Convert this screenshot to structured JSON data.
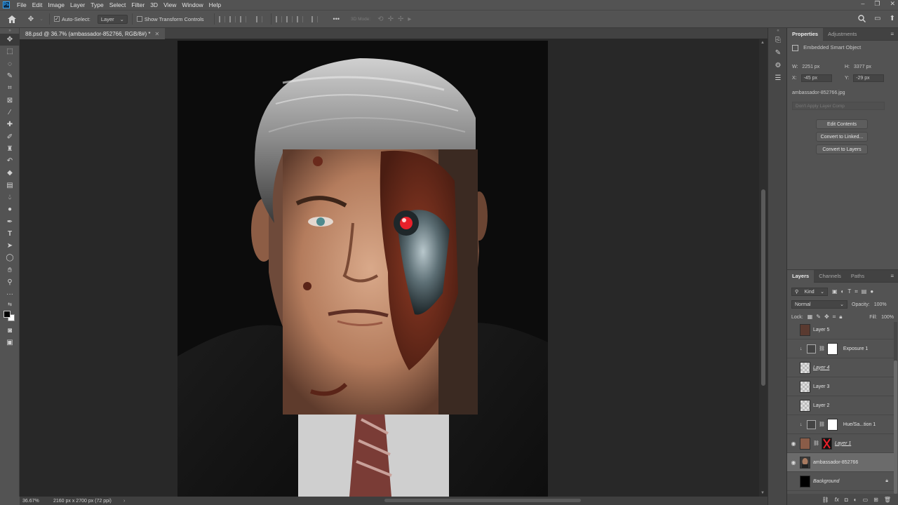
{
  "menubar": {
    "app_logo": "Ps",
    "items": [
      "File",
      "Edit",
      "Image",
      "Layer",
      "Type",
      "Select",
      "Filter",
      "3D",
      "View",
      "Window",
      "Help"
    ],
    "minimize": "–",
    "restore": "❐",
    "close": "✕"
  },
  "options_bar": {
    "auto_select_label": "Auto-Select:",
    "auto_select_checked": "✓",
    "auto_select_target": "Layer",
    "show_transform_label": "Show Transform Controls",
    "more": "•••",
    "mode_3d": "3D Mode:"
  },
  "document": {
    "tab_title": "88.psd @ 36.7% (ambassador-852766, RGB/8#) *",
    "close": "✕"
  },
  "status": {
    "zoom": "36.67%",
    "doc_info": "2160 px x 2700 px (72 ppi)",
    "arrow": "›"
  },
  "properties": {
    "tabs": [
      "Properties",
      "Adjustments"
    ],
    "type_label": "Embedded Smart Object",
    "w_label": "W:",
    "w_value": "2251 px",
    "h_label": "H:",
    "h_value": "3377 px",
    "x_label": "X:",
    "x_value": "-45 px",
    "y_label": "Y:",
    "y_value": "-29 px",
    "filename": "ambassador-852766.jpg",
    "layer_comp_placeholder": "Don't Apply Layer Comp",
    "buttons": [
      "Edit Contents",
      "Convert to Linked...",
      "Convert to Layers"
    ]
  },
  "layers_panel": {
    "tabs": [
      "Layers",
      "Channels",
      "Paths"
    ],
    "filter_kind": "Kind",
    "blend_mode": "Normal",
    "opacity_label": "Opacity:",
    "opacity_value": "100%",
    "lock_label": "Lock:",
    "fill_label": "Fill:",
    "fill_value": "100%",
    "layers": [
      {
        "name": "Layer 5",
        "visible": false,
        "italic": false
      },
      {
        "name": "Exposure 1",
        "visible": false,
        "italic": false
      },
      {
        "name": "Layer 4",
        "visible": false,
        "italic": true
      },
      {
        "name": "Layer 3",
        "visible": false,
        "italic": false
      },
      {
        "name": "Layer 2",
        "visible": false,
        "italic": false
      },
      {
        "name": "Hue/Sa...tion 1",
        "visible": false,
        "italic": false
      },
      {
        "name": "Layer 1",
        "visible": true,
        "italic": true
      },
      {
        "name": "ambassador-852766",
        "visible": true,
        "italic": false,
        "selected": true
      },
      {
        "name": "Background",
        "visible": false,
        "italic": true
      }
    ]
  },
  "colors": {
    "accent": "#31a8ff",
    "cyborg_eye": "#e8202a"
  }
}
